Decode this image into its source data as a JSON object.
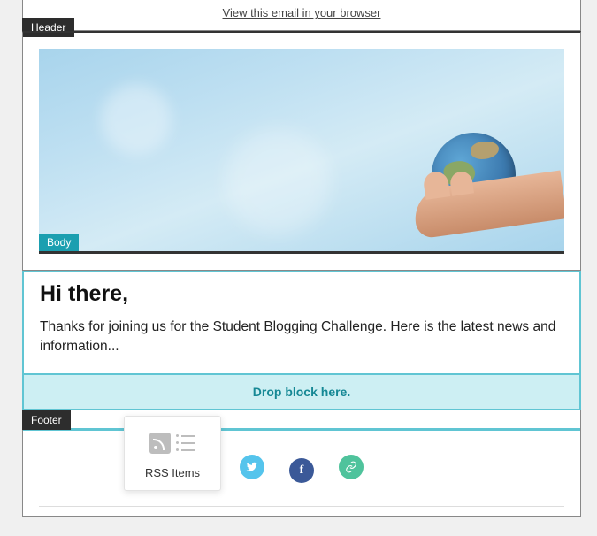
{
  "topbar": {
    "view_link": "View this email in your browser"
  },
  "labels": {
    "header": "Header",
    "body": "Body",
    "footer": "Footer"
  },
  "body": {
    "greeting": "Hi there,",
    "text": "Thanks for joining us for the Student Blogging Challenge. Here is the latest news and information..."
  },
  "dropzone": {
    "text": "Drop block here."
  },
  "drag_block": {
    "label": "RSS Items"
  },
  "social": {
    "twitter": "twitter",
    "facebook": "facebook",
    "link": "link"
  }
}
